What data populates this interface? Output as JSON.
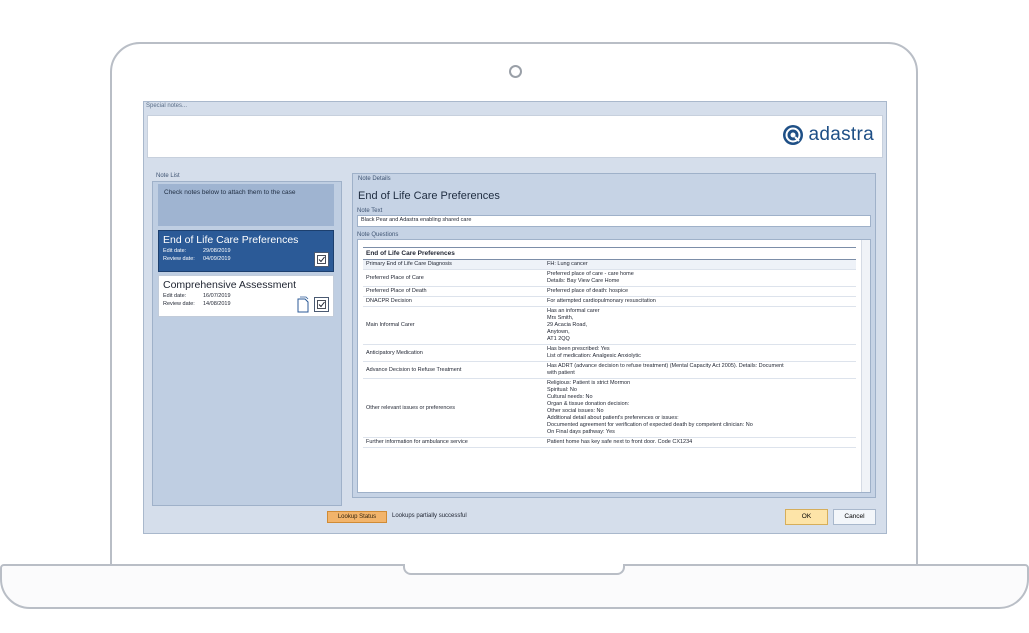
{
  "window": {
    "title": "Special notes..."
  },
  "brand": {
    "name": "adastra",
    "color": "#1e4f86",
    "icon": "adastra-logo-icon"
  },
  "note_list": {
    "label": "Note List",
    "hint": "Check notes below to attach them to the case",
    "cards": [
      {
        "title": "End of Life Care Preferences",
        "edit_label": "Edit date:",
        "edit_date": "29/08/2019",
        "review_label": "Review date:",
        "review_date": "04/09/2019",
        "selected": true,
        "checked": true
      },
      {
        "title": "Comprehensive Assessment",
        "edit_label": "Edit date:",
        "edit_date": "16/07/2019",
        "review_label": "Review date:",
        "review_date": "14/08/2019",
        "selected": false,
        "checked": true
      }
    ]
  },
  "details": {
    "label": "Note Details",
    "title": "End of Life Care Preferences",
    "note_text_label": "Note Text",
    "note_text": "Black Pear and Adastra enabling shared care",
    "questions_label": "Note Questions",
    "table_header": "End of Life Care Preferences",
    "rows": [
      {
        "q": "Primary End of Life Care Diagnosis",
        "a": "FH: Lung cancer"
      },
      {
        "q": "Preferred Place of Care",
        "a": "Preferred place of care - care home\nDetails: Bay View Care Home"
      },
      {
        "q": "Preferred Place of Death",
        "a": "Preferred place of death: hospice"
      },
      {
        "q": "DNACPR Decision",
        "a": "For attempted cardiopulmonary resuscitation"
      },
      {
        "q": "Main Informal Carer",
        "a": "Has an informal carer\nMrs Smith,\n29 Acacia Road,\nAnytown,\nAT1 2QQ"
      },
      {
        "q": "Anticipatory Medication",
        "a": "Has been prescribed: Yes\nList of medication: Analgesic Anxiolytic"
      },
      {
        "q": "Advance Decision to Refuse Treatment",
        "a": "Has ADRT (advance decision to refuse treatment) (Mental Capacity Act 2005). Details: Document\nwith patient"
      },
      {
        "q": "Other relevant issues or preferences",
        "a": "Religious: Patient is strict Mormon\nSpiritual: No\nCultural needs: No\nOrgan & tissue donation decision:\nOther social issues: No\nAdditional detail about patient's preferences or issues:\nDocumented agreement for verification of expected death by competent clinician: No\nOn Final days pathway: Yes"
      },
      {
        "q": "Further information for ambulance service",
        "a": "Patient home has key safe next to front door. Code CX1234"
      }
    ]
  },
  "footer": {
    "lookup_button": "Lookup Status",
    "lookup_message": "Lookups partially successful",
    "ok_label": "OK",
    "cancel_label": "Cancel"
  }
}
